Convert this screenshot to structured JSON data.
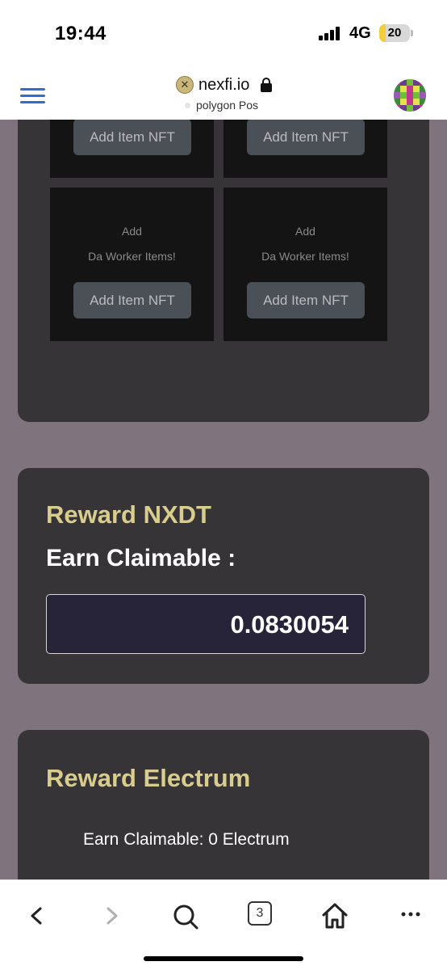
{
  "status_bar": {
    "time": "19:44",
    "network": "4G",
    "battery_level": "20",
    "battery_fraction": 0.2
  },
  "browser": {
    "site_logo_glyph": "✕",
    "site": "nexfi.io",
    "network_name": "polygon Pos",
    "secure": true
  },
  "nft_slots": {
    "button_label": "Add Item NFT",
    "add_text": "Add",
    "worker_text": "Da Worker Items!"
  },
  "reward_nxdt": {
    "title": "Reward NXDT",
    "label": "Earn Claimable :",
    "value": "0.0830054"
  },
  "reward_electrum": {
    "title": "Reward Electrum",
    "line": "Earn Claimable: 0 Electrum"
  },
  "toolbar": {
    "tabs_count": "3",
    "icons": [
      "chevron-left-icon",
      "chevron-right-icon",
      "search-icon",
      "tabs-icon",
      "home-icon",
      "more-icon"
    ]
  },
  "colors": {
    "page_bg": "#7f747e",
    "card_bg": "#363436",
    "accent_gold": "#d8cd8e",
    "menu_blue": "#2a72c9"
  }
}
